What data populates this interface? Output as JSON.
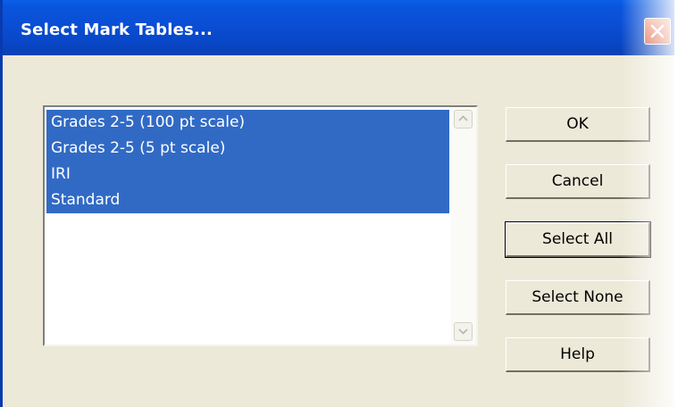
{
  "dialog": {
    "title": "Select Mark Tables...",
    "close_icon": "close-icon"
  },
  "list": {
    "items": [
      {
        "label": "Grades 2-5 (100 pt scale)",
        "selected": true
      },
      {
        "label": "Grades 2-5 (5 pt scale)",
        "selected": true
      },
      {
        "label": "IRI",
        "selected": true
      },
      {
        "label": "Standard",
        "selected": true
      }
    ],
    "scroll_up_icon": "chevron-up-icon",
    "scroll_down_icon": "chevron-down-icon"
  },
  "buttons": {
    "ok": "OK",
    "cancel": "Cancel",
    "select_all": "Select All",
    "select_none": "Select None",
    "help": "Help"
  },
  "colors": {
    "titlebar": "#0a4fd6",
    "selection": "#316ac5",
    "dialog_bg": "#ece9d8",
    "close_button": "#e77a5f"
  }
}
